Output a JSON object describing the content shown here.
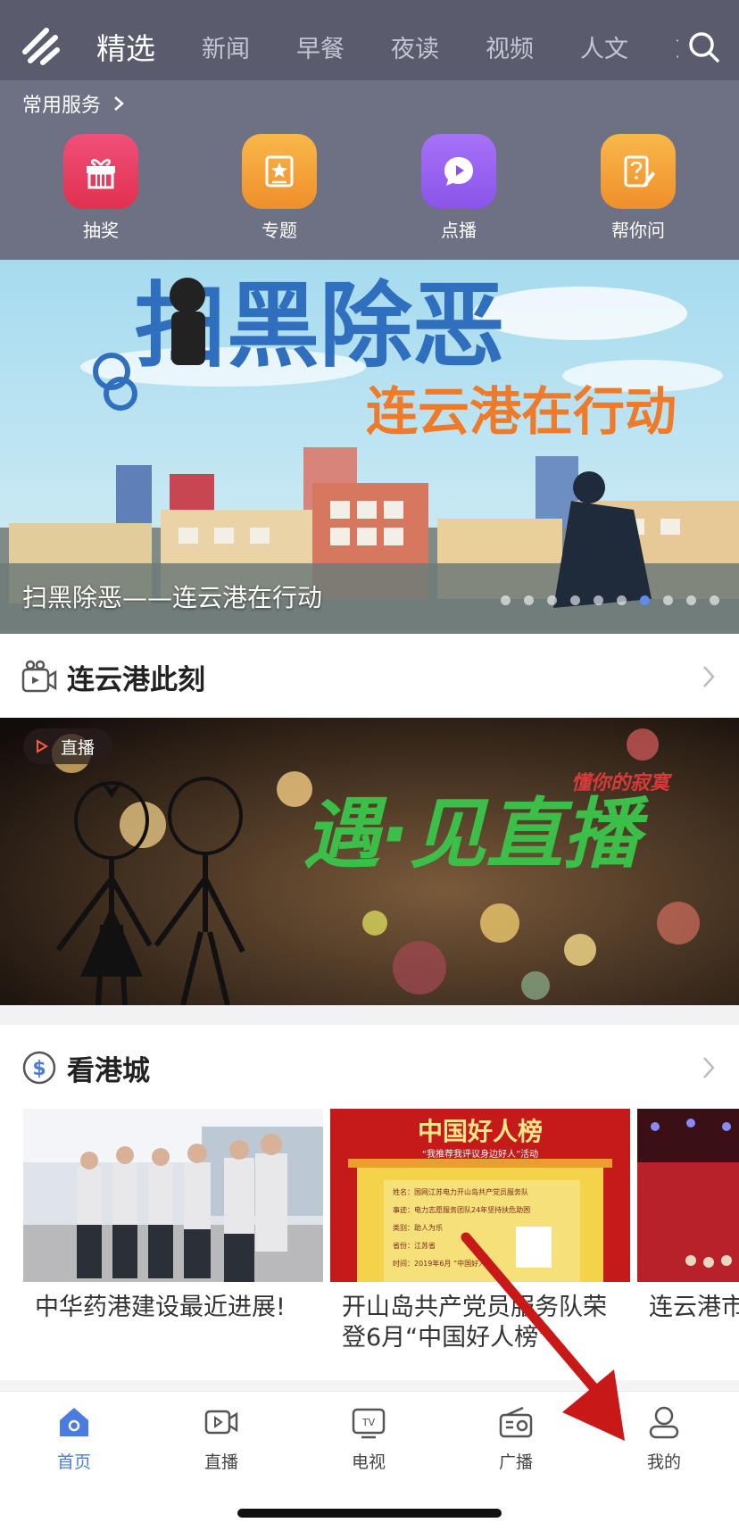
{
  "header": {
    "tabs": [
      {
        "label": "精选",
        "active": true
      },
      {
        "label": "新闻",
        "active": false
      },
      {
        "label": "早餐",
        "active": false
      },
      {
        "label": "夜读",
        "active": false
      },
      {
        "label": "视频",
        "active": false
      },
      {
        "label": "人文",
        "active": false
      },
      {
        "label": "东",
        "active": false
      }
    ],
    "logo_icon": "app-logo-icon",
    "search_icon": "search-icon"
  },
  "services": {
    "title": "常用服务",
    "items": [
      {
        "label": "抽奖",
        "icon": "gift-icon",
        "color": "#ea3a62"
      },
      {
        "label": "专题",
        "icon": "star-card-icon",
        "color": "#f4a33a"
      },
      {
        "label": "点播",
        "icon": "play-bubble-icon",
        "color": "#9862f0"
      },
      {
        "label": "帮你问",
        "icon": "question-note-icon",
        "color": "#f4a33a"
      }
    ]
  },
  "banner": {
    "title_big": "扫黑除恶",
    "title_sub": "连云港在行动",
    "caption": "扫黑除恶——连云港在行动",
    "page_count": 10,
    "active_index": 6
  },
  "section_now": {
    "title": "连云港此刻"
  },
  "live": {
    "badge": "直播",
    "art_title": "遇·见直播",
    "art_tag": "懂你的寂寞"
  },
  "section_city": {
    "title": "看港城"
  },
  "cards": [
    {
      "title": "中华药港建设最近进展!"
    },
    {
      "title": "开山岛共产党员服务队荣登6月“中国好人榜”",
      "poster": {
        "heading": "中国好人榜",
        "slogan": "“我推荐我评议身边好人”活动",
        "rows": [
          "姓名：国网江苏电力开山岛共产党员服务队",
          "事迹：电力志愿服务团队24年坚持扶危助困",
          "类别：助人为乐",
          "省份：江苏省",
          "时间：2019年6月 “中国好人”"
        ]
      }
    },
    {
      "title": "连云港市产党员、"
    }
  ],
  "nav": {
    "items": [
      {
        "label": "首页",
        "icon": "home-icon",
        "active": true
      },
      {
        "label": "直播",
        "icon": "live-video-icon",
        "active": false
      },
      {
        "label": "电视",
        "icon": "tv-icon",
        "active": false
      },
      {
        "label": "广播",
        "icon": "radio-icon",
        "active": false
      },
      {
        "label": "我的",
        "icon": "user-icon",
        "active": false
      }
    ]
  },
  "colors": {
    "accent": "#4a7be0",
    "header": "#5a5c6e",
    "annotation_arrow": "#c81818"
  }
}
